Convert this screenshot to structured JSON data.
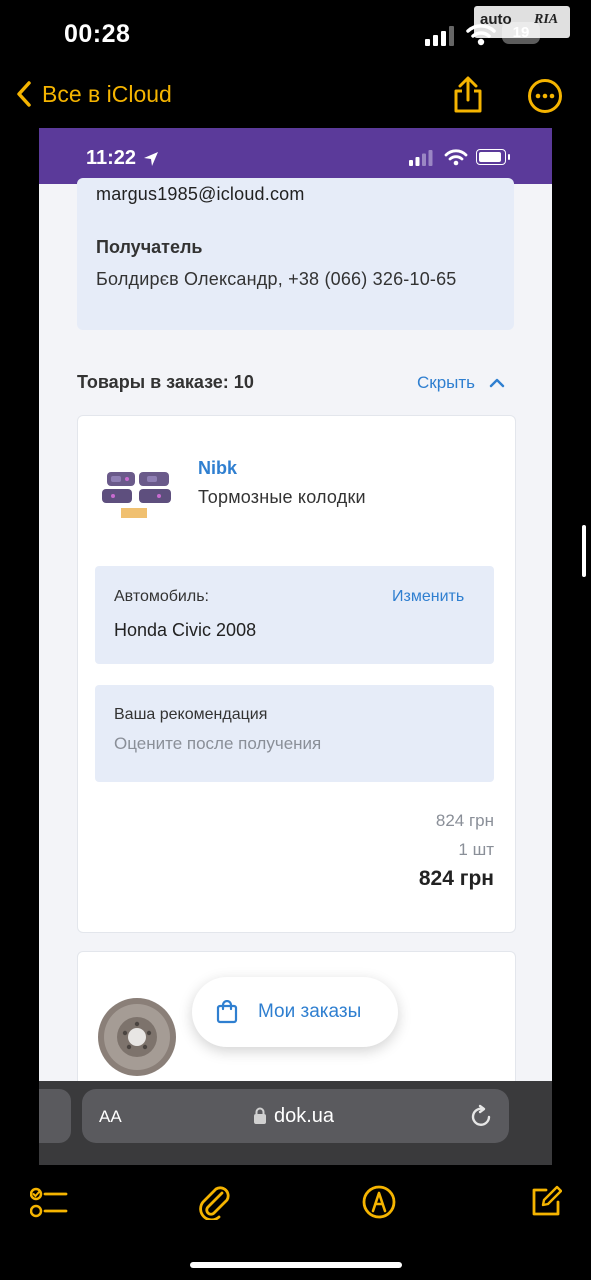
{
  "ios": {
    "time": "00:28",
    "battery": "19",
    "watermark_left": "auto",
    "watermark_right": "RIA"
  },
  "notes_nav": {
    "back_label": "Все в iCloud",
    "accent_color": "#f5b400"
  },
  "inner": {
    "status_time": "11:22",
    "status_color": "#5b3a9a",
    "customer_email": "margus1985@icloud.com",
    "recipient_label": "Получатель",
    "recipient_value": "Болдирєв Олександр, +38 (066) 326-10-65",
    "goods_title": "Товары в заказе: 10",
    "hide_link": "Скрыть",
    "product": {
      "brand": "Nibk",
      "name": "Тормозные колодки",
      "car_label": "Автомобиль:",
      "car_change": "Изменить",
      "car_value": "Honda Civic 2008",
      "recommend_title": "Ваша рекомендация",
      "recommend_hint": "Оцените после получения",
      "price_unit": "824 грн",
      "quantity": "1 шт",
      "total": "824 грн"
    },
    "orders_button": "Мои заказы",
    "browser": {
      "aa_label": "AA",
      "domain": "dok.ua"
    },
    "link_color": "#2f7fd0"
  }
}
